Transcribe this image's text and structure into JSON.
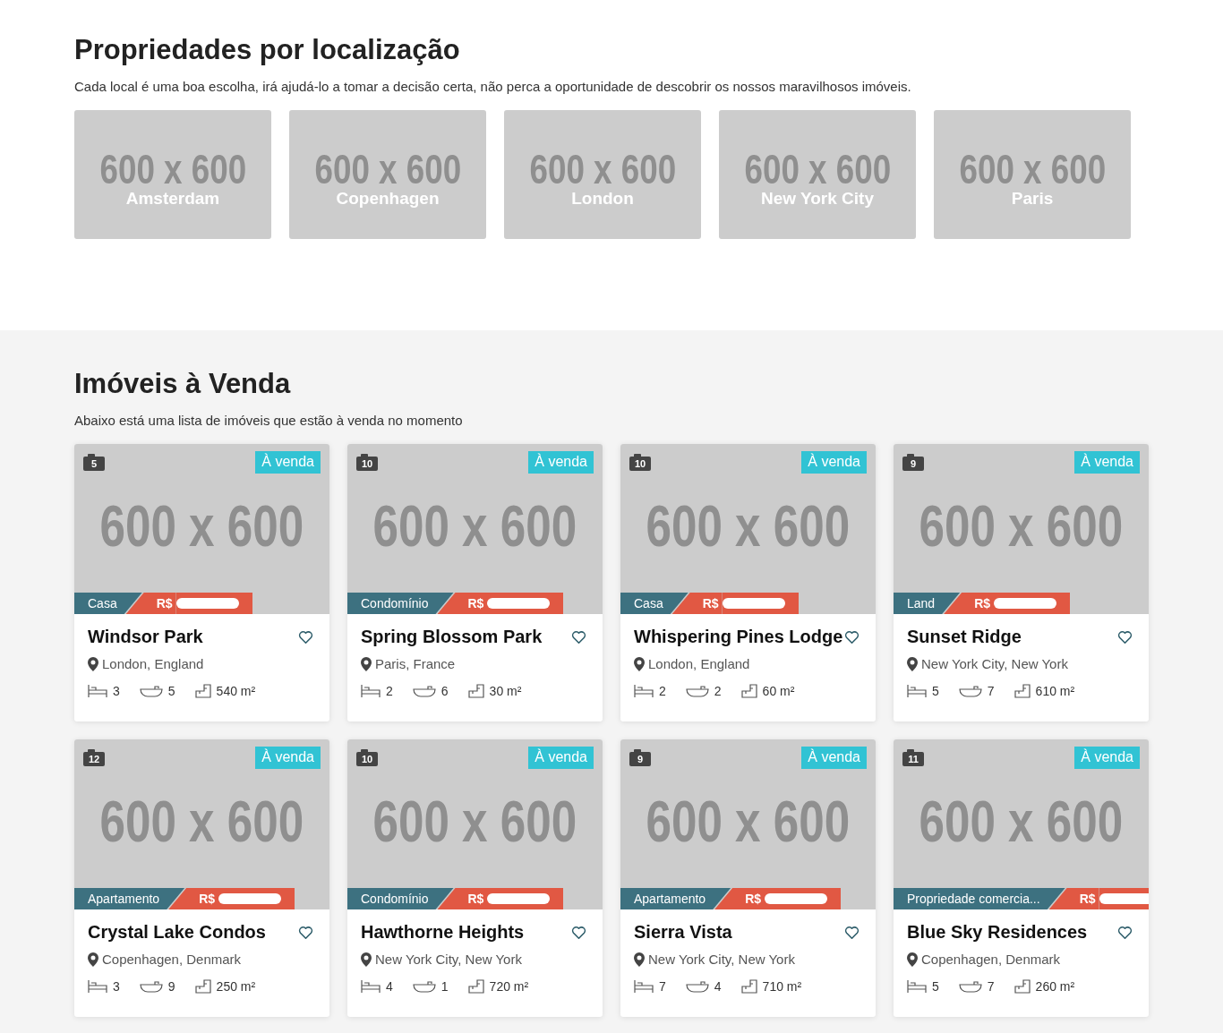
{
  "locations": {
    "title": "Propriedades por localização",
    "subtitle": "Cada local é uma boa escolha, irá ajudá-lo a tomar a decisão certa, não perca a oportunidade de descobrir os nossos maravilhosos imóveis.",
    "items": [
      {
        "placeholder": "600 x 600",
        "name": "Amsterdam"
      },
      {
        "placeholder": "600 x 600",
        "name": "Copenhagen"
      },
      {
        "placeholder": "600 x 600",
        "name": "London"
      },
      {
        "placeholder": "600 x 600",
        "name": "New York City"
      },
      {
        "placeholder": "600 x 600",
        "name": "Paris"
      }
    ]
  },
  "listings": {
    "title": "Imóveis à Venda",
    "subtitle": "Abaixo está uma lista de imóveis que estão à venda no momento",
    "items": [
      {
        "photos": "5",
        "status": "À venda",
        "placeholder": "600 x 600",
        "type": "Casa",
        "price": "R$",
        "name": "Windsor Park",
        "location": "London, England",
        "beds": "3",
        "baths": "5",
        "area": "540 m²"
      },
      {
        "photos": "10",
        "status": "À venda",
        "placeholder": "600 x 600",
        "type": "Condomínio",
        "price": "R$",
        "name": "Spring Blossom Park",
        "location": "Paris, France",
        "beds": "2",
        "baths": "6",
        "area": "30 m²"
      },
      {
        "photos": "10",
        "status": "À venda",
        "placeholder": "600 x 600",
        "type": "Casa",
        "price": "R$",
        "name": "Whispering Pines Lodge",
        "location": "London, England",
        "beds": "2",
        "baths": "2",
        "area": "60 m²"
      },
      {
        "photos": "9",
        "status": "À venda",
        "placeholder": "600 x 600",
        "type": "Land",
        "price": "R$",
        "name": "Sunset Ridge",
        "location": "New York City, New York",
        "beds": "5",
        "baths": "7",
        "area": "610 m²"
      },
      {
        "photos": "12",
        "status": "À venda",
        "placeholder": "600 x 600",
        "type": "Apartamento",
        "price": "R$",
        "name": "Crystal Lake Condos",
        "location": "Copenhagen, Denmark",
        "beds": "3",
        "baths": "9",
        "area": "250 m²"
      },
      {
        "photos": "10",
        "status": "À venda",
        "placeholder": "600 x 600",
        "type": "Condomínio",
        "price": "R$",
        "name": "Hawthorne Heights",
        "location": "New York City, New York",
        "beds": "4",
        "baths": "1",
        "area": "720 m²"
      },
      {
        "photos": "9",
        "status": "À venda",
        "placeholder": "600 x 600",
        "type": "Apartamento",
        "price": "R$",
        "name": "Sierra Vista",
        "location": "New York City, New York",
        "beds": "7",
        "baths": "4",
        "area": "710 m²"
      },
      {
        "photos": "11",
        "status": "À venda",
        "placeholder": "600 x 600",
        "type": "Propriedade comercia...",
        "price": "R$",
        "name": "Blue Sky Residences",
        "location": "Copenhagen, Denmark",
        "beds": "5",
        "baths": "7",
        "area": "260 m²"
      }
    ]
  }
}
